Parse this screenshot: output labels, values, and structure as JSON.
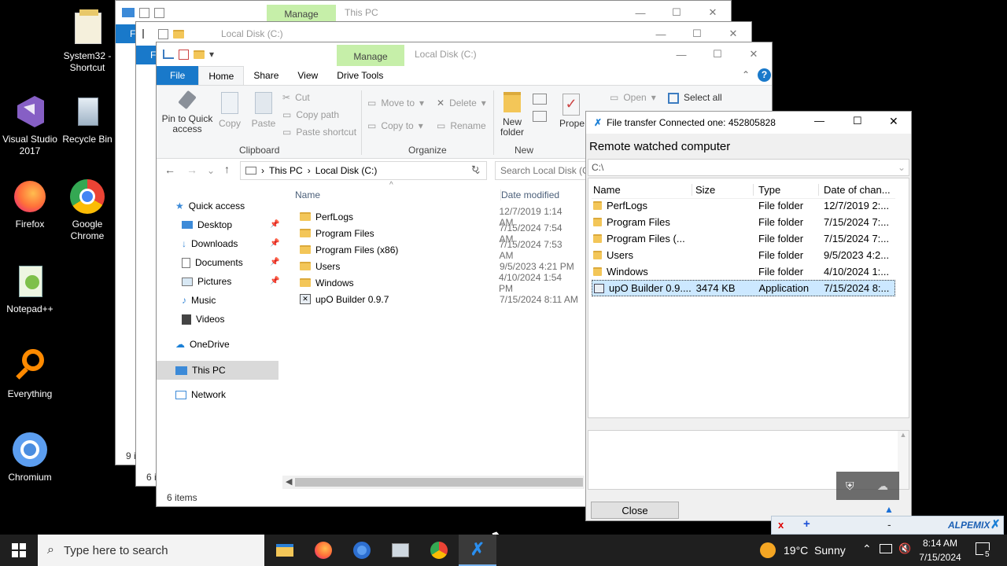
{
  "desktop_icons": [
    {
      "label": "System32 - Shortcut",
      "icon": "folder-shortcut-icon"
    },
    {
      "label": "Visual Studio 2017",
      "icon": "visual-studio-icon"
    },
    {
      "label": "Recycle Bin",
      "icon": "recycle-bin-icon"
    },
    {
      "label": "Firefox",
      "icon": "firefox-icon"
    },
    {
      "label": "Google Chrome",
      "icon": "chrome-icon"
    },
    {
      "label": "Notepad++",
      "icon": "notepad-plus-icon"
    },
    {
      "label": "Everything",
      "icon": "everything-search-icon"
    },
    {
      "label": "Chromium",
      "icon": "chromium-icon"
    }
  ],
  "back_window_1": {
    "manage": "Manage",
    "title": "This PC",
    "tab_file": "F",
    "status": "9 i"
  },
  "back_window_2": {
    "title": "Local Disk (C:)",
    "tab_file": "F",
    "status": "6 i"
  },
  "explorer": {
    "title": "Local Disk (C:)",
    "manage": "Manage",
    "tabs": {
      "file": "File",
      "home": "Home",
      "share": "Share",
      "view": "View",
      "drive_tools": "Drive Tools"
    },
    "ribbon": {
      "pin": "Pin to Quick access",
      "copy": "Copy",
      "paste": "Paste",
      "cut": "Cut",
      "copy_path": "Copy path",
      "paste_shortcut": "Paste shortcut",
      "clipboard": "Clipboard",
      "move_to": "Move to",
      "copy_to": "Copy to",
      "delete": "Delete",
      "rename": "Rename",
      "organize": "Organize",
      "new_folder": "New folder",
      "new": "New",
      "properties": "Prope",
      "open": "Open",
      "select_all": "Select all"
    },
    "address": {
      "this_pc": "This PC",
      "local_disk": "Local Disk (C:)",
      "search_placeholder": "Search Local Disk (C:)"
    },
    "columns": {
      "name": "Name",
      "date": "Date modified"
    },
    "nav": [
      {
        "label": "Quick access"
      },
      {
        "label": "Desktop"
      },
      {
        "label": "Downloads"
      },
      {
        "label": "Documents"
      },
      {
        "label": "Pictures"
      },
      {
        "label": "Music"
      },
      {
        "label": "Videos"
      },
      {
        "label": "OneDrive"
      },
      {
        "label": "This PC"
      },
      {
        "label": "Network"
      }
    ],
    "files": [
      {
        "name": "PerfLogs",
        "date": "12/7/2019 1:14 AM"
      },
      {
        "name": "Program Files",
        "date": "7/15/2024 7:54 AM"
      },
      {
        "name": "Program Files (x86)",
        "date": "7/15/2024 7:53 AM"
      },
      {
        "name": "Users",
        "date": "9/5/2023 4:21 PM"
      },
      {
        "name": "Windows",
        "date": "4/10/2024 1:54 PM"
      },
      {
        "name": "upO Builder 0.9.7",
        "date": "7/15/2024 8:11 AM"
      }
    ],
    "status": "6 items"
  },
  "transfer": {
    "title": "File transfer Connected one: 452805828",
    "heading": "Remote watched computer",
    "path": "C:\\",
    "columns": {
      "name": "Name",
      "size": "Size",
      "type": "Type",
      "date": "Date of chan..."
    },
    "rows": [
      {
        "name": "PerfLogs",
        "size": "",
        "type": "File folder",
        "date": "12/7/2019 2:..."
      },
      {
        "name": "Program Files",
        "size": "",
        "type": "File folder",
        "date": "7/15/2024 7:..."
      },
      {
        "name": "Program Files (...",
        "size": "",
        "type": "File folder",
        "date": "7/15/2024 7:..."
      },
      {
        "name": "Users",
        "size": "",
        "type": "File folder",
        "date": "9/5/2023 4:2..."
      },
      {
        "name": "Windows",
        "size": "",
        "type": "File folder",
        "date": "4/10/2024 1:..."
      },
      {
        "name": "upO Builder 0.9....",
        "size": "3474 KB",
        "type": "Application",
        "date": "7/15/2024 8:..."
      }
    ],
    "close": "Close"
  },
  "alpemix": {
    "brand": "ALPEMIX",
    "x": "x",
    "plus": "+",
    "minus": "-"
  },
  "taskbar": {
    "search_placeholder": "Type here to search",
    "weather": "19°C  Sunny",
    "time": "8:14 AM",
    "date": "7/15/2024",
    "notif_count": "5"
  },
  "colors": {
    "accent": "#1979ca",
    "manage": "#c6efa9",
    "taskbar": "#1f1f1f"
  }
}
